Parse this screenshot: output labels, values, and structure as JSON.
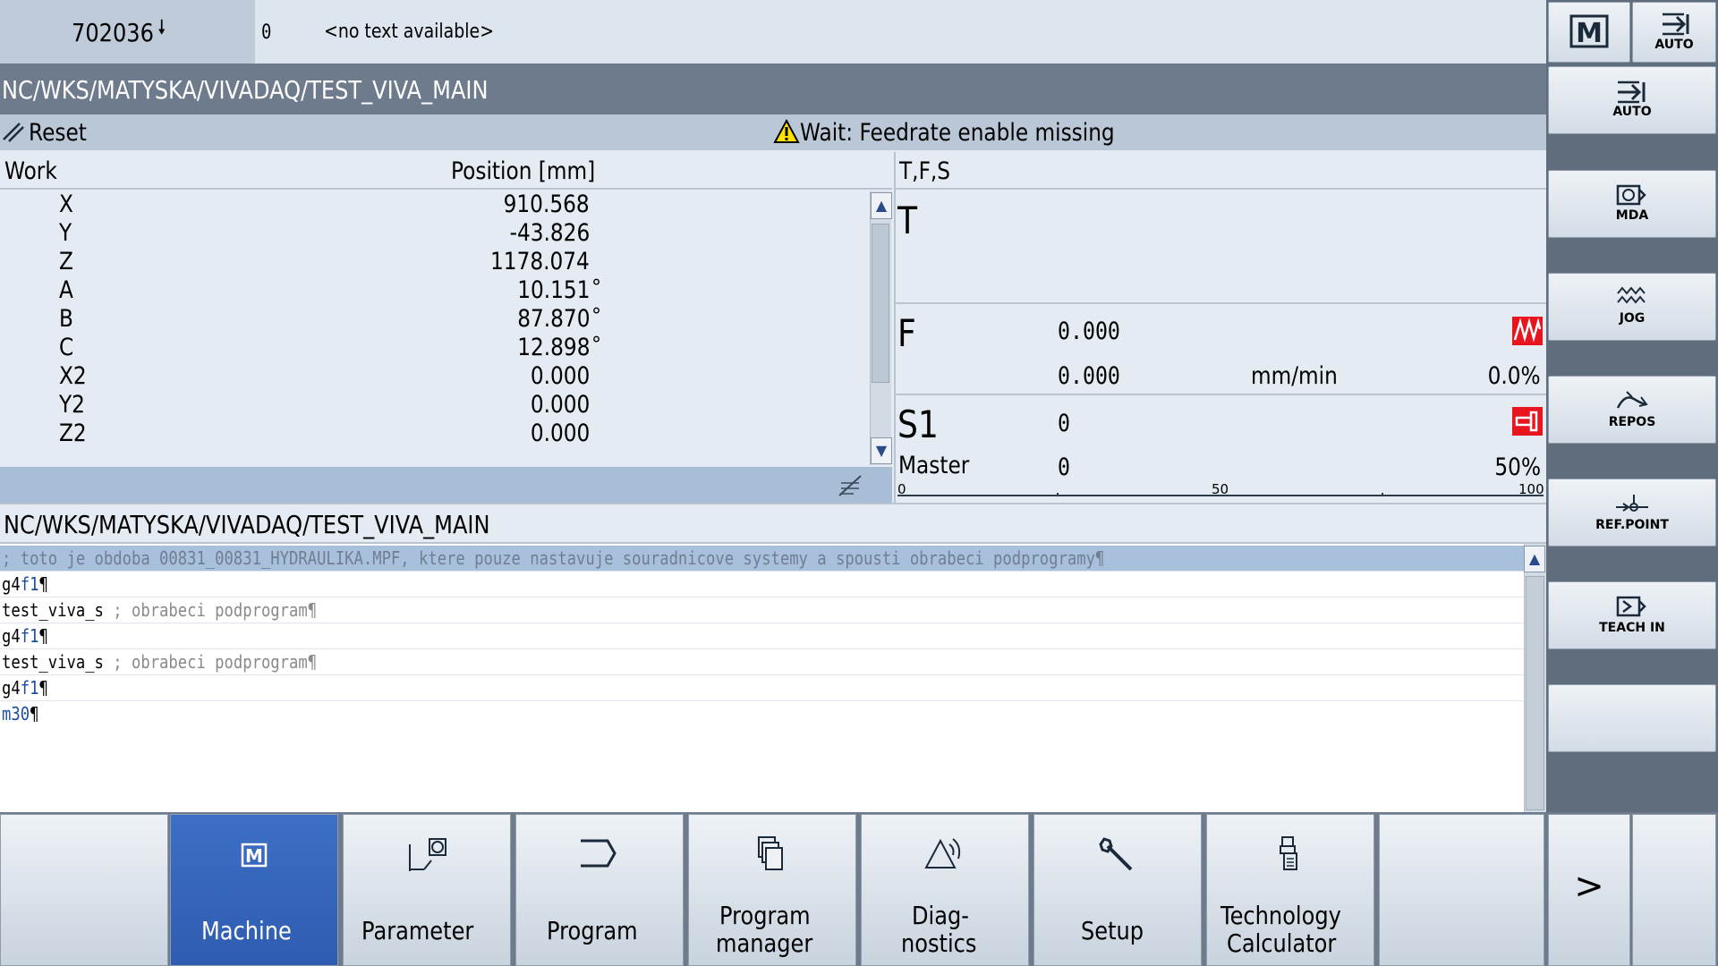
{
  "alarm": {
    "number": "702036",
    "arrow": "🠗",
    "zero": "0",
    "text": "<no text available>"
  },
  "program_path": "NC/WKS/MATYSKA/VIVADAQ/TEST_VIVA_MAIN",
  "status": {
    "channel_state": "Reset",
    "message": "Wait: Feedrate enable missing"
  },
  "position": {
    "col_work": "Work",
    "col_position": "Position [mm]",
    "axes": [
      {
        "name": "X",
        "value": "910.568",
        "unit": ""
      },
      {
        "name": "Y",
        "value": "-43.826",
        "unit": ""
      },
      {
        "name": "Z",
        "value": "1178.074",
        "unit": ""
      },
      {
        "name": "A",
        "value": "10.151",
        "unit": "°"
      },
      {
        "name": "B",
        "value": "87.870",
        "unit": "°"
      },
      {
        "name": "C",
        "value": "12.898",
        "unit": "°"
      },
      {
        "name": "X2",
        "value": "0.000",
        "unit": ""
      },
      {
        "name": "Y2",
        "value": "0.000",
        "unit": ""
      },
      {
        "name": "Z2",
        "value": "0.000",
        "unit": ""
      }
    ]
  },
  "tfs": {
    "title": "T,F,S",
    "t_label": "T",
    "f_label": "F",
    "f_value": "0.000",
    "f_value2": "0.000",
    "f_unit": "mm/min",
    "f_override": "0.0%",
    "s_label": "S1",
    "s_value": "0",
    "master_label": "Master",
    "master_value": "0",
    "master_override": "50%",
    "ticks": [
      "0",
      "50",
      "100"
    ]
  },
  "editor": {
    "title": "NC/WKS/MATYSKA/VIVADAQ/TEST_VIVA_MAIN",
    "lines": [
      {
        "code": "",
        "comment": "; toto je obdoba 00831_00831_HYDRAULIKA.MPF, ktere pouze nastavuje souradnicove systemy a spousti obrabeci podprogramy¶"
      },
      {
        "code_a": "g4",
        "code_b": "f1",
        "end": "¶"
      },
      {
        "code": "test_viva_s ",
        "comment": "; obrabeci podprogram¶"
      },
      {
        "code_a": "g4",
        "code_b": "f1",
        "end": "¶"
      },
      {
        "code": "test_viva_s ",
        "comment": "; obrabeci podprogram¶"
      },
      {
        "code_a": "g4",
        "code_b": "f1",
        "end": "¶"
      },
      {
        "code_kw": "m30",
        "end": "¶"
      }
    ]
  },
  "vertical_softkeys": [
    {
      "label": "AUTO",
      "icon": "auto-icon"
    },
    {
      "label": "MDA",
      "icon": "mda-icon"
    },
    {
      "label": "JOG",
      "icon": "jog-icon"
    },
    {
      "label": "REPOS",
      "icon": "repos-icon"
    },
    {
      "label": "REF.POINT",
      "icon": "refpoint-icon"
    },
    {
      "label": "TEACH IN",
      "icon": "teachin-icon"
    },
    {
      "label": "",
      "icon": ""
    }
  ],
  "top_right": {
    "machine_label": "M",
    "auto_label": "AUTO"
  },
  "horizontal_softkeys": [
    {
      "label": "",
      "icon": ""
    },
    {
      "label": "Machine",
      "icon": "machine-icon"
    },
    {
      "label": "Parameter",
      "icon": "parameter-icon"
    },
    {
      "label": "Program",
      "icon": "program-icon"
    },
    {
      "label_1": "Program",
      "label_2": "manager",
      "icon": "program-manager-icon"
    },
    {
      "label_1": "Diag-",
      "label_2": "nostics",
      "icon": "diagnostics-icon"
    },
    {
      "label": "Setup",
      "icon": "wrench-icon"
    },
    {
      "label_1": "Technology",
      "label_2": "Calculator",
      "icon": "calculator-icon"
    },
    {
      "label": "",
      "icon": ""
    },
    {
      "label": ">",
      "icon": ""
    }
  ],
  "colors": {
    "active_softkey": "#2e5cb0",
    "alarm_red": "#e8141e",
    "status_bar": "#b9c7d6"
  }
}
